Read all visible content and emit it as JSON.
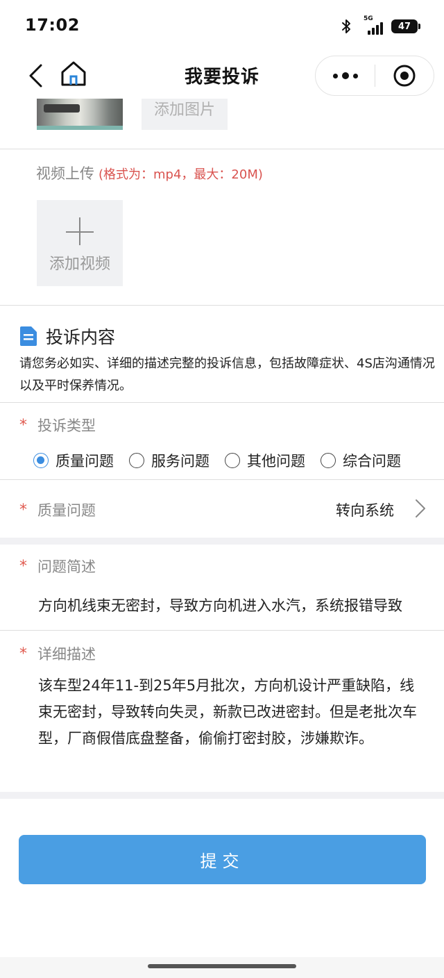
{
  "status_bar": {
    "time": "17:02",
    "network": "5G",
    "battery": "47"
  },
  "nav": {
    "title": "我要投诉"
  },
  "image_upload": {
    "add_label": "添加图片"
  },
  "video_upload": {
    "label": "视频上传",
    "hint": "(格式为：mp4，最大：20M)",
    "add_label": "添加视频"
  },
  "complaint": {
    "title": "投诉内容",
    "description": "请您务必如实、详细的描述完整的投诉信息，包括故障症状、4S店沟通情况以及平时保养情况。"
  },
  "form": {
    "type_label": "投诉类型",
    "type_options": [
      "质量问题",
      "服务问题",
      "其他问题",
      "综合问题"
    ],
    "type_selected": "质量问题",
    "quality_label": "质量问题",
    "quality_value": "转向系统",
    "summary_label": "问题简述",
    "summary_value": "方向机线束无密封，导致方向机进入水汽，系统报错导致",
    "detail_label": "详细描述",
    "detail_value": "该车型24年11-到25年5月批次，方向机设计严重缺陷，线束无密封，导致转向失灵，新款已改进密封。但是老批次车型，厂商假借底盘整备，偷偷打密封胶，涉嫌欺诈。",
    "required_mark": "*"
  },
  "submit": {
    "label": "提交"
  },
  "colors": {
    "accent": "#4a9ee3",
    "required": "#e05a4f",
    "hint": "#d9534f"
  }
}
